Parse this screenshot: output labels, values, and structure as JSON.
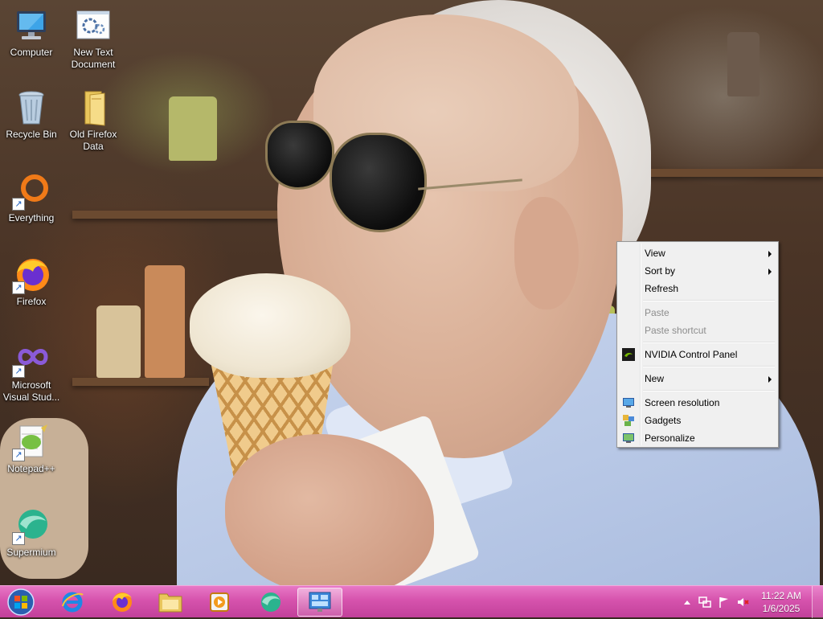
{
  "desktop": {
    "icons": [
      {
        "label": "Computer",
        "icon": "computer-icon",
        "shortcut": false
      },
      {
        "label": "New Text\nDocument",
        "icon": "text-document-icon",
        "shortcut": false
      },
      {
        "label": "Recycle Bin",
        "icon": "recycle-bin-icon",
        "shortcut": false
      },
      {
        "label": "Old Firefox\nData",
        "icon": "folder-icon",
        "shortcut": false
      },
      {
        "label": "Everything",
        "icon": "everything-search-icon",
        "shortcut": true
      },
      {
        "label": "Firefox",
        "icon": "firefox-icon",
        "shortcut": true
      },
      {
        "label": "Microsoft\nVisual Stud...",
        "icon": "visual-studio-icon",
        "shortcut": true
      },
      {
        "label": "Notepad++",
        "icon": "notepad-plus-plus-icon",
        "shortcut": true
      },
      {
        "label": "Supermium",
        "icon": "supermium-icon",
        "shortcut": true
      }
    ]
  },
  "context_menu": {
    "items": [
      {
        "label": "View",
        "submenu": true,
        "disabled": false
      },
      {
        "label": "Sort by",
        "submenu": true,
        "disabled": false
      },
      {
        "label": "Refresh",
        "submenu": false,
        "disabled": false
      },
      {
        "label": "Paste",
        "submenu": false,
        "disabled": true
      },
      {
        "label": "Paste shortcut",
        "submenu": false,
        "disabled": true
      },
      {
        "label": "NVIDIA Control Panel",
        "submenu": false,
        "disabled": false,
        "icon": "nvidia-icon"
      },
      {
        "label": "New",
        "submenu": true,
        "disabled": false
      },
      {
        "label": "Screen resolution",
        "submenu": false,
        "disabled": false,
        "icon": "monitor-icon"
      },
      {
        "label": "Gadgets",
        "submenu": false,
        "disabled": false,
        "icon": "gadgets-icon"
      },
      {
        "label": "Personalize",
        "submenu": false,
        "disabled": false,
        "icon": "personalize-icon"
      }
    ]
  },
  "taskbar": {
    "pinned": [
      {
        "name": "internet-explorer",
        "icon": "internet-explorer-icon",
        "active": false
      },
      {
        "name": "firefox",
        "icon": "firefox-icon",
        "active": false
      },
      {
        "name": "file-explorer",
        "icon": "folder-icon",
        "active": false
      },
      {
        "name": "media-player",
        "icon": "media-player-icon",
        "active": false
      },
      {
        "name": "supermium",
        "icon": "supermium-icon",
        "active": false
      },
      {
        "name": "control-panel-window",
        "icon": "control-panel-icon",
        "active": true
      }
    ],
    "tray": {
      "icons": [
        "show-hidden-icons-icon",
        "network-icon",
        "action-center-flag-icon",
        "volume-muted-icon"
      ],
      "time": "11:22 AM",
      "date": "1/6/2025"
    }
  },
  "colors": {
    "taskbar": "#d653ad",
    "menu_background": "#f0f0f0",
    "disabled_text": "#8d8d8d"
  }
}
